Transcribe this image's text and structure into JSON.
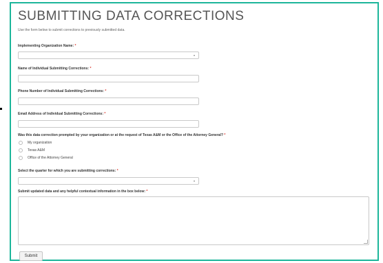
{
  "form": {
    "title": "SUBMITTING DATA CORRECTIONS",
    "intro": "Use the form below to submit corrections to previously submitted data.",
    "required_marker": "*",
    "select_caret": "▾",
    "fields": {
      "org": {
        "label": "Implementing Organization Name:",
        "value": ""
      },
      "name": {
        "label": "Name of Individual Submitting Corrections:",
        "value": ""
      },
      "phone": {
        "label": "Phone Number of Individual Submitting Corrections:",
        "value": ""
      },
      "email": {
        "label": "Email Address of Individual Submitting Corrections:",
        "value": ""
      },
      "prompted": {
        "label": "Was this data correction prompted by your organization or at the request of Texas A&M or the Office of the Attorney General?",
        "options": [
          "My organization",
          "Texas A&M",
          "Office of the Attorney General"
        ]
      },
      "quarter": {
        "label": "Select the quarter for which you are submitting corrections:",
        "value": ""
      },
      "details": {
        "label": "Submit updated data and any helpful contextual information in the box below:",
        "value": ""
      }
    },
    "submit_label": "Submit"
  },
  "colors": {
    "accent_border": "#1bb59a",
    "required": "#d9342b"
  }
}
